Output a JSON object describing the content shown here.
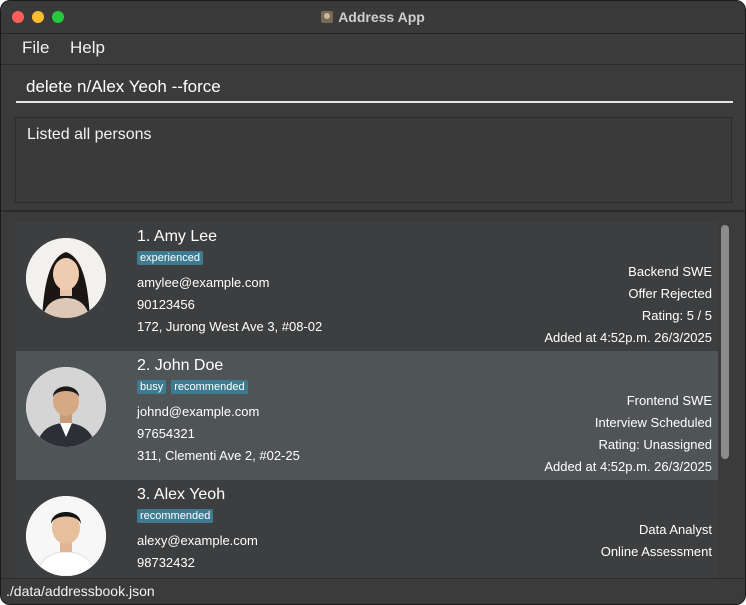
{
  "window": {
    "title": "Address App"
  },
  "menu": {
    "file": "File",
    "help": "Help"
  },
  "command": {
    "value": "delete n/Alex Yeoh --force"
  },
  "result": {
    "text": "Listed all persons"
  },
  "persons": [
    {
      "name": "1. Amy Lee",
      "tags": [
        "experienced"
      ],
      "email": "amylee@example.com",
      "phone": "90123456",
      "address": "172, Jurong West Ave 3, #08-02",
      "role": "Backend SWE",
      "stage": "Offer Rejected",
      "rating": "Rating: 5 / 5",
      "added": "Added at 4:52p.m. 26/3/2025"
    },
    {
      "name": "2. John Doe",
      "tags": [
        "busy",
        "recommended"
      ],
      "email": "johnd@example.com",
      "phone": "97654321",
      "address": "311, Clementi Ave 2, #02-25",
      "role": "Frontend SWE",
      "stage": "Interview Scheduled",
      "rating": "Rating: Unassigned",
      "added": "Added at 4:52p.m. 26/3/2025"
    },
    {
      "name": "3. Alex Yeoh",
      "tags": [
        "recommended"
      ],
      "email": "alexy@example.com",
      "phone": "98732432",
      "role": "Data Analyst",
      "stage": "Online Assessment"
    }
  ],
  "status": {
    "path": "./data/addressbook.json"
  }
}
